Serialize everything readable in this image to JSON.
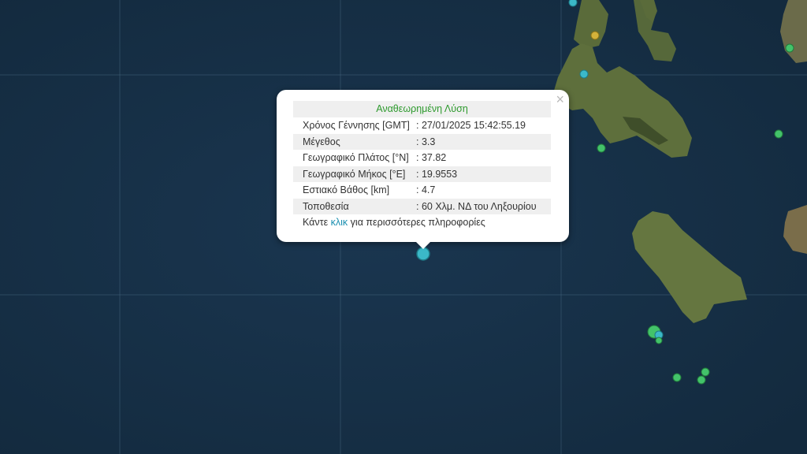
{
  "popup": {
    "close_symbol": "×",
    "title": "Αναθεωρημένη Λύση",
    "rows": [
      {
        "label": "Χρόνος Γέννησης [GMT]",
        "value": ": 27/01/2025 15:42:55.19"
      },
      {
        "label": "Μέγεθος",
        "value": ": 3.3"
      },
      {
        "label": "Γεωγραφικό Πλάτος [°N]",
        "value": ": 37.82"
      },
      {
        "label": "Γεωγραφικό Μήκος [°E]",
        "value": ": 19.9553"
      },
      {
        "label": "Εστιακό Βάθος [km]",
        "value": ": 4.7"
      },
      {
        "label": "Τοποθεσία",
        "value": ": 60 Χλμ. ΝΔ του Ληξουρίου"
      }
    ],
    "more_prefix": "Κάντε ",
    "more_link": "κλικ",
    "more_suffix": " για περισσότερες πληροφορίες"
  },
  "colors": {
    "sea": "#163046",
    "land": "#5d6e3c",
    "title_green": "#2e9a2e",
    "link": "#1a8fb0",
    "quake_cyan": "#3bb8c8",
    "quake_green": "#43c36a",
    "quake_yellow": "#d4b23a"
  },
  "markers": [
    {
      "name": "selected-quake",
      "color": "cyan"
    },
    {
      "name": "quake-cyan",
      "color": "cyan"
    },
    {
      "name": "quake-cyan",
      "color": "cyan"
    },
    {
      "name": "quake-yellow",
      "color": "yellow"
    },
    {
      "name": "quake-green",
      "color": "green"
    }
  ]
}
